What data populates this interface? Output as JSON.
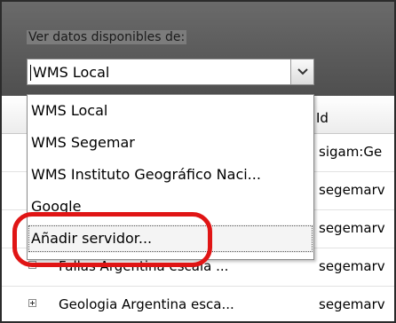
{
  "source_picker": {
    "label": "Ver datos disponibles de:",
    "selected": "WMS Local",
    "options": [
      "WMS Local",
      "WMS Segemar",
      "WMS Instituto Geográfico Naci...",
      "Google",
      "Añadir servidor..."
    ]
  },
  "grid": {
    "id_header": "Id",
    "rows": [
      {
        "name": "",
        "id": "sigam:Ge"
      },
      {
        "name": "",
        "id": "segemarv"
      },
      {
        "name": "",
        "id": "segemarv"
      },
      {
        "name": "Fallas Argentina escala ...",
        "id": "segemarv"
      },
      {
        "name": "Geologia Argentina esca...",
        "id": "segemarv"
      }
    ]
  },
  "colors": {
    "header_gray": "#5f5f5f",
    "highlight_red": "#e01515"
  }
}
